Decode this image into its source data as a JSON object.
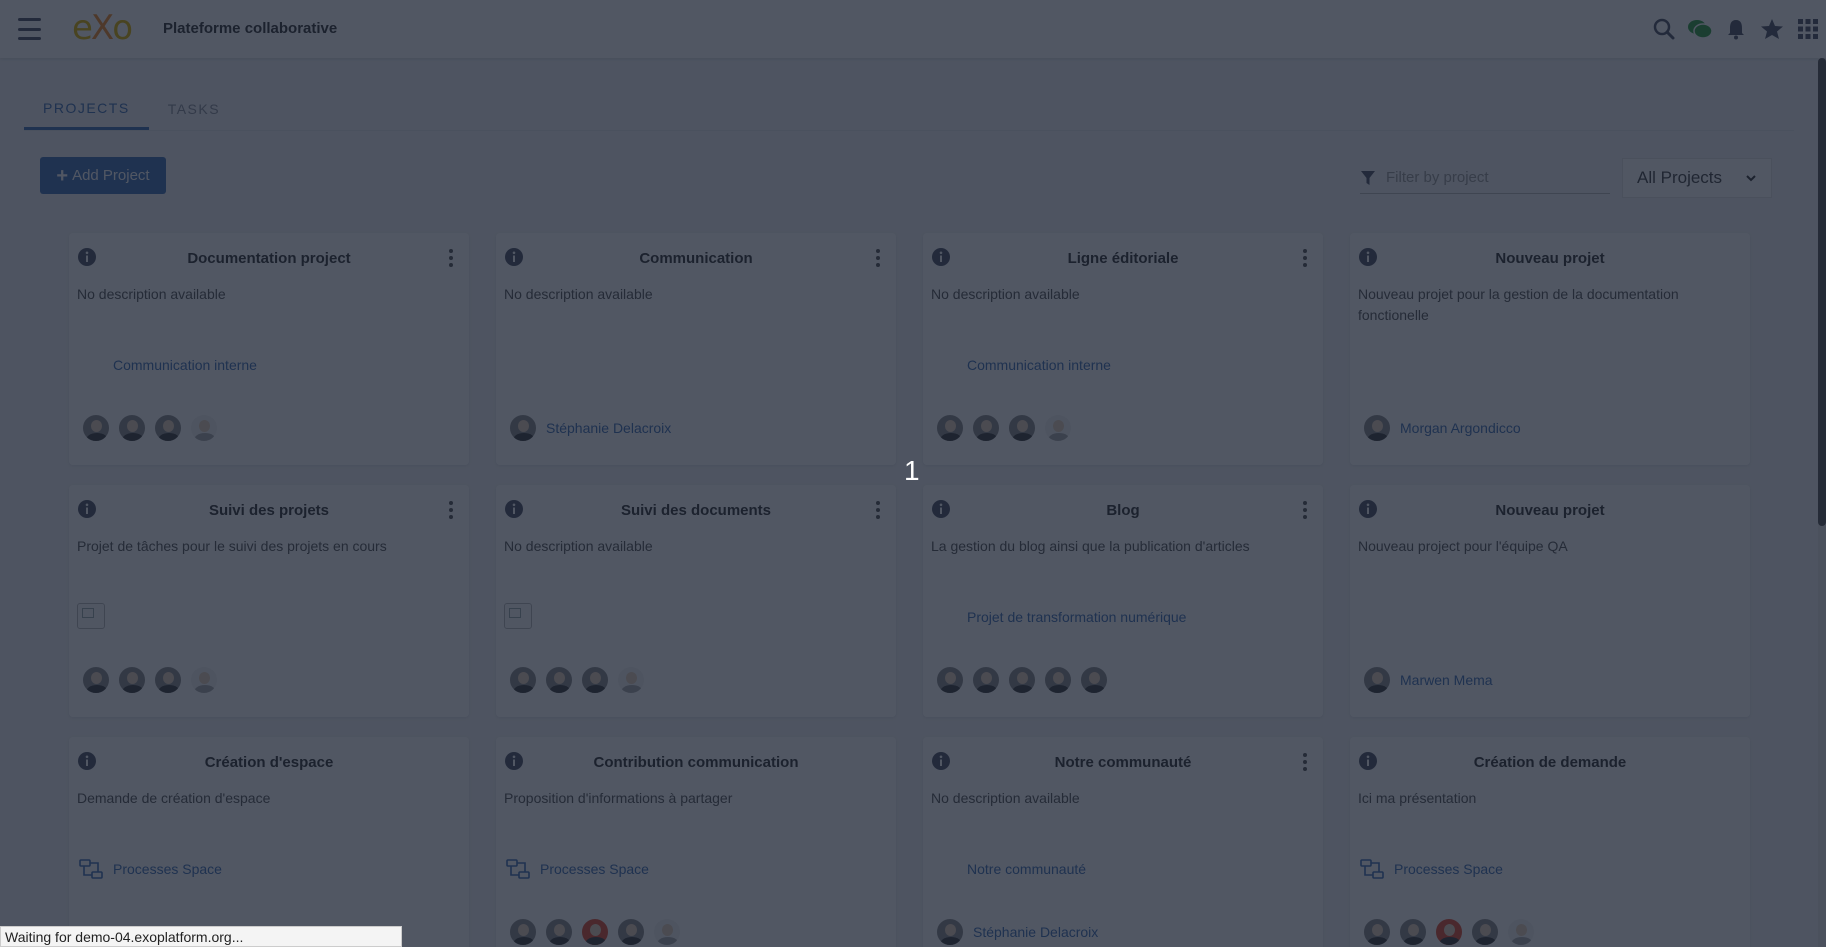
{
  "header": {
    "logo_text": "eXo",
    "title": "Plateforme collaborative",
    "icons": [
      "search-icon",
      "chat-icon",
      "bell-icon",
      "star-icon",
      "apps-grid-icon"
    ],
    "chat_color": "#2e9e3e"
  },
  "tabs": [
    {
      "label": "PROJECTS",
      "active": true
    },
    {
      "label": "TASKS",
      "active": false
    }
  ],
  "toolbar": {
    "add_project_label": "Add Project",
    "filter_placeholder": "Filter by project",
    "select_value": "All Projects"
  },
  "accent": "#3f6fb5",
  "cards": [
    {
      "title": "Documentation project",
      "description": "No description available",
      "space": "Communication interne",
      "members": [
        "avatar",
        "avatar",
        "avatar",
        "more"
      ],
      "menu": true
    },
    {
      "title": "Communication",
      "description": "No description available",
      "space": "",
      "members": [
        "avatar"
      ],
      "member_name": "Stéphanie Delacroix",
      "menu": true
    },
    {
      "title": "Ligne éditoriale",
      "description": "No description available",
      "space": "Communication interne",
      "members": [
        "avatar",
        "avatar",
        "avatar",
        "more"
      ],
      "menu": true
    },
    {
      "title": "Nouveau projet",
      "description": "Nouveau projet pour la gestion de la documentation fonctionelle",
      "space": "",
      "members": [
        "avatar"
      ],
      "member_name": "Morgan Argondicco",
      "menu": false
    },
    {
      "title": "Suivi des projets",
      "description": "Projet de tâches pour le suivi des projets en cours",
      "space": "broken-image",
      "members": [
        "avatar",
        "avatar",
        "avatar",
        "more"
      ],
      "menu": true
    },
    {
      "title": "Suivi des documents",
      "description": "No description available",
      "space": "broken-image",
      "members": [
        "avatar",
        "avatar",
        "avatar",
        "more"
      ],
      "menu": true
    },
    {
      "title": "Blog",
      "description": "La gestion du blog ainsi que la publication d'articles",
      "space": "Projet de transformation numérique",
      "members": [
        "avatar",
        "avatar",
        "avatar",
        "avatar",
        "avatar"
      ],
      "menu": true
    },
    {
      "title": "Nouveau projet",
      "description": "Nouveau project pour l'équipe QA",
      "space": "",
      "members": [
        "avatar"
      ],
      "member_name": "Marwen Mema",
      "menu": false
    },
    {
      "title": "Création d'espace",
      "description": "Demande de création d'espace",
      "space": "Processes Space",
      "members": [],
      "menu": false
    },
    {
      "title": "Contribution communication",
      "description": "Proposition d'informations à partager",
      "space": "Processes Space",
      "members": [
        "avatar",
        "avatar",
        "red",
        "avatar",
        "more"
      ],
      "menu": false
    },
    {
      "title": "Notre communauté",
      "description": "No description available",
      "space": "Notre communauté",
      "members": [
        "avatar"
      ],
      "member_name": "Stéphanie Delacroix",
      "menu": true
    },
    {
      "title": "Création de demande",
      "description": "Ici ma présentation",
      "space": "Processes Space",
      "members": [
        "avatar",
        "avatar",
        "red",
        "avatar",
        "more"
      ],
      "menu": false
    }
  ],
  "overlay": {
    "number": "1",
    "status": "Waiting for demo-04.exoplatform.org..."
  }
}
